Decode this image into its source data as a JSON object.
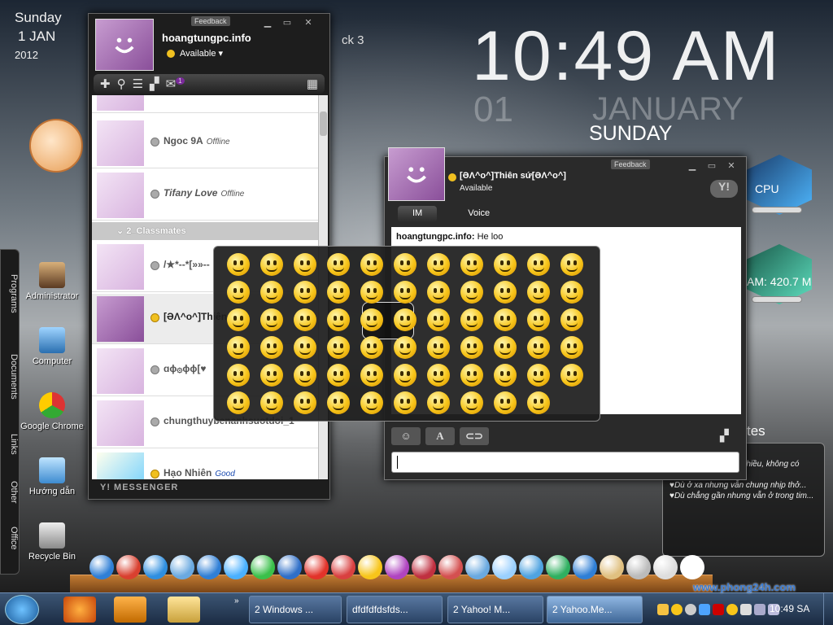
{
  "desktop": {
    "date": {
      "weekday": "Sunday",
      "daymonth": "1 JAN",
      "year": "2012"
    },
    "clock": {
      "time": "10:49 AM",
      "day": "01",
      "month": "JANUARY",
      "weekday": "SUNDAY"
    },
    "bg_fragment": "ck 3",
    "gauges": {
      "cpu_label": "CPU",
      "ram_label": "AM: 420.7 M"
    },
    "notes_title": "tes",
    "notes_lines": [
      "nh, không có",
      "♥Không nói chuyện nhiều, không có nghĩa là không nhớ...",
      "♥Dù ở xa nhưng vẫn chung nhịp thở...",
      "♥Dù chẳng gần nhưng vẫn ở trong tim..."
    ],
    "sidebar_tabs": [
      "Programs",
      "Documents",
      "Links",
      "Other",
      "Office"
    ],
    "icons": [
      {
        "label": "Administrator",
        "icon": "user-icon"
      },
      {
        "label": "Computer",
        "icon": "computer-icon"
      },
      {
        "label": "Google Chrome",
        "icon": "chrome-icon"
      },
      {
        "label": "Hướng dẫn",
        "icon": "guide-icon"
      },
      {
        "label": "Recycle Bin",
        "icon": "recycle-bin-icon"
      }
    ]
  },
  "messenger": {
    "feedback": "Feedback",
    "username": "hoangtungpc.info",
    "status": "Available",
    "mail_count": "1",
    "contacts": [
      {
        "name": "Ngoc 9A",
        "status": "Offline",
        "online": false
      },
      {
        "name": "Tifany Love",
        "status": "Offline",
        "online": false
      }
    ],
    "group": "2_Classmates",
    "group_contacts": [
      {
        "name": "/★*--*[»»--",
        "status": "",
        "online": false
      },
      {
        "name": "[ƏΛ^o^]Thiên",
        "status": "",
        "online": true
      },
      {
        "name": "ɑɸ۞ɸɸ[♥",
        "status": "",
        "online": false
      },
      {
        "name": "chungthuybenanhsuotdoi_1",
        "status": "",
        "online": false
      },
      {
        "name": "Hạo Nhiên",
        "status": "Good",
        "online": true
      }
    ],
    "logo": "Y! MESSENGER"
  },
  "chat": {
    "feedback": "Feedback",
    "contact_name": "[ƏΛ^o^]Thiên sứ[ƏΛ^o^]",
    "contact_status": "Available",
    "tabs": [
      "IM",
      "Voice"
    ],
    "messages": [
      {
        "sender": "hoangtungpc.info:",
        "text": "He loo"
      }
    ],
    "tools": [
      "☺",
      "A",
      "⊂⊃"
    ]
  },
  "taskbar": {
    "tasks": [
      {
        "label": "2 Windows ...",
        "active": false
      },
      {
        "label": "dfdfdfdsfds...",
        "active": false
      },
      {
        "label": "2 Yahoo! M...",
        "active": false
      },
      {
        "label": "2 Yahoo.Me...",
        "active": true
      }
    ],
    "time": "10:49 SA",
    "watermark": "www.phong24h.com"
  },
  "colors": {
    "accent": "#3c5675",
    "ym_purple": "#a56fb4",
    "emoticon": "#f7c51a"
  }
}
